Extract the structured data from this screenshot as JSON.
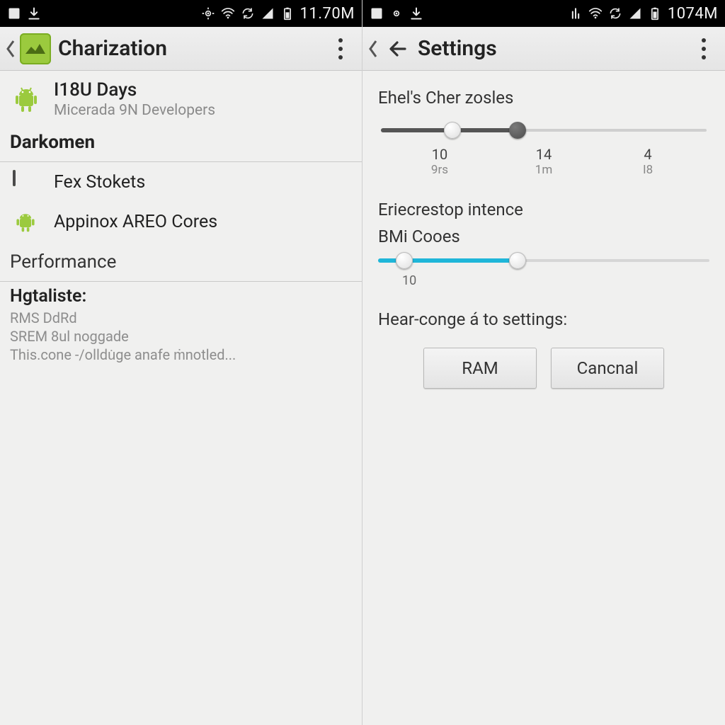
{
  "left": {
    "statusbar": {
      "time": "11.70M"
    },
    "actionbar": {
      "title": "Charization"
    },
    "featured": {
      "title": "I18U Days",
      "subtitle": "Micerada 9N Developers"
    },
    "section1": {
      "title": "Darkomen"
    },
    "items": [
      {
        "label": "Fex Stokets"
      },
      {
        "label": "Appinox AREO Cores"
      }
    ],
    "section2": {
      "title": "Performance"
    },
    "perf": {
      "heading": "Hgtaliste:",
      "line1": "RMS DdRd",
      "line2": "SREM 8ul noggade",
      "line3": "This.cone -/olldu̇ge anafe ṁnotled..."
    }
  },
  "right": {
    "statusbar": {
      "time": "1074M"
    },
    "actionbar": {
      "title": "Settings"
    },
    "slider1": {
      "title": "Ehel's Cher zosles",
      "ticks": [
        {
          "top": "10",
          "bottom": "9rs"
        },
        {
          "top": "14",
          "bottom": "1m"
        },
        {
          "top": "4",
          "bottom": "I8"
        }
      ],
      "fill_percent": 42,
      "thumb_light_percent": 22,
      "thumb_dark_percent": 42
    },
    "slider2": {
      "title": "Eriecrestop intence",
      "sublabel": "BMi Cooes",
      "fill_percent": 42,
      "thumb_light_percent": 8,
      "thumb_dark_percent": 42,
      "tick_label": "10"
    },
    "heading": "Hear-conge á to settings:",
    "buttons": {
      "primary": "RAM",
      "secondary": "Cancnal"
    }
  }
}
